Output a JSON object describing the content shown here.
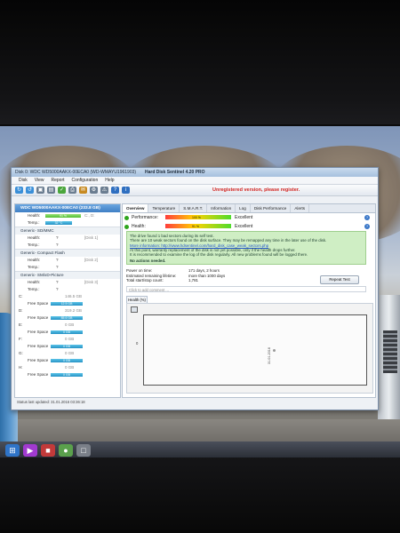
{
  "window": {
    "title": "Disk 0: WDC WD5000AAKX-00ECA0 (WD-WMAYU1961903)",
    "app_title": "Hard Disk Sentinel 4.20 PRO",
    "unregistered_notice": "Unregistered version, please register."
  },
  "menu": [
    "Disk",
    "View",
    "Report",
    "Configuration",
    "Help"
  ],
  "left_pane": {
    "disk_header": "WDC WD5000AAKX-00ECA0 (233.8 GB)",
    "health_label": "Health:",
    "health_value": "91 %",
    "temp_label": "Temp.:",
    "temp_value": "32 °C",
    "drive_letters": "C:, D:",
    "group1_title": "Generic- SD/MMC",
    "g1_health_label": "Health:",
    "g1_health_value": "?",
    "g1_health_right": "[Disk 1]",
    "g1_temp_label": "Temp.:",
    "g1_temp_value": "?",
    "group2_title": "Generic- Compact Flash",
    "g2_health_label": "Health:",
    "g2_health_value": "?",
    "g2_health_right": "[Disk 2]",
    "g2_temp_label": "Temp.:",
    "g2_temp_value": "?",
    "group3_title": "Generic- SM/xD-Picture",
    "g3_health_label": "Health:",
    "g3_health_value": "?",
    "g3_health_right": "[Disk 3]",
    "g3_temp_label": "Temp.:",
    "g3_temp_value": "?",
    "volume_c": "C:",
    "volume_c_size": "146.5 GB",
    "free_space_label": "Free Space",
    "volume_c_free": "12.5 GB",
    "volume_d": "D:",
    "volume_d_size": "319.2 GB",
    "volume_d_free": "85.6 GB",
    "volume_e": "E:",
    "volume_f": "F:",
    "volume_g": "G:",
    "volume_h": "H:",
    "volume_zero": "0 GB",
    "status": "Status last updated: 31.01.2016 03:36:18"
  },
  "tabs": [
    "Overview",
    "Temperature",
    "S.M.A.R.T.",
    "Information",
    "Log",
    "Disk Performance",
    "Alerts"
  ],
  "right_pane": {
    "performance_label": "Performance:",
    "performance_value": "100 %",
    "performance_word": "Excellent",
    "health_label": "Health:",
    "health_value": "91 %",
    "health_word": "Excellent",
    "info_line1": "The drive found 1 bad sectors during its self test.",
    "info_line2": "There are 10 weak sectors found on the disk surface. They may be remapped any time in the later use of the disk.",
    "info_line3": "More information: http://www.hdsentinel.com/hard_disk_case_weak_sectors.php",
    "info_line4": "At this point, warranty replacement of the disk is not yet possible, only if the health drops further.",
    "info_line5": "It is recommended to examine the log of the disk regularly. All new problems found will be logged there.",
    "info_bold": "No actions needed.",
    "power_on_label": "Power on time:",
    "power_on_value": "171 days, 2 hours",
    "lifetime_label": "Estimated remaining lifetime:",
    "lifetime_value": "more than 1000 days",
    "start_stop_label": "Total start/stop count:",
    "start_stop_value": "1,781",
    "repeat_test": "Repeat Test",
    "comment_placeholder": "Click to add comment ...",
    "health_subtab": "Health (%)",
    "chart_y_label": "0",
    "chart_x_label": "31.01.2016"
  },
  "chart_data": {
    "type": "scatter",
    "x": [
      "31.01.2016"
    ],
    "y": [
      91
    ],
    "xlabel": "",
    "ylabel": ""
  }
}
